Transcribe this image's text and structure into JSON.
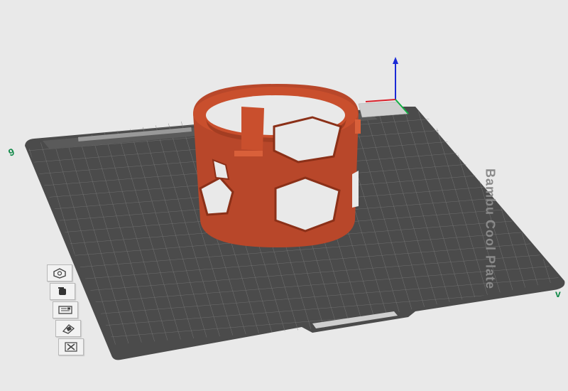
{
  "viewport": {
    "bed_label": "Bambu Cool Plate",
    "axis_markers": {
      "left": "9",
      "right": "v"
    }
  },
  "model": {
    "color": "#c94f2d"
  },
  "colors": {
    "background": "#e9e9e9",
    "bed": "#4b4b4b",
    "grid": "#7a7a7a",
    "axis_z": "#1a2ad6",
    "axis_x": "#d9202a",
    "axis_y": "#12b043"
  },
  "toolbar": [
    {
      "icon": "arrange-icon",
      "tooltip": ""
    },
    {
      "icon": "orient-icon",
      "tooltip": ""
    },
    {
      "icon": "plate-settings-icon",
      "tooltip": ""
    },
    {
      "icon": "layers-icon",
      "tooltip": ""
    },
    {
      "icon": "delete-plate-icon",
      "tooltip": ""
    }
  ]
}
